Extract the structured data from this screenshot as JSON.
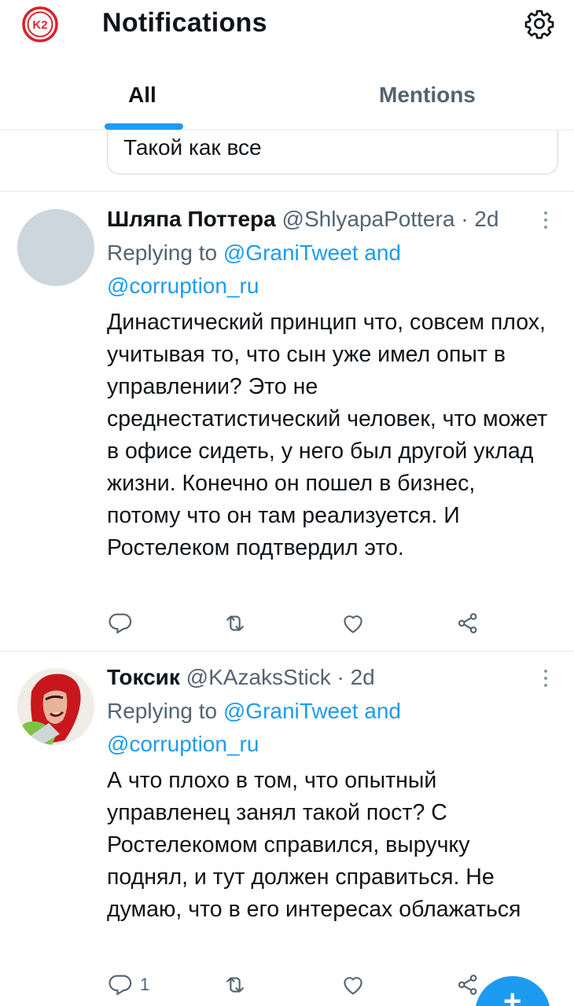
{
  "header": {
    "title": "Notifications",
    "logo_icon": "k2-logo-icon",
    "settings_icon": "gear-icon"
  },
  "tabs": [
    {
      "label": "All",
      "active": true
    },
    {
      "label": "Mentions",
      "active": false
    }
  ],
  "previous_item": {
    "text": "Такой как все"
  },
  "tweets": [
    {
      "name": "Шляпа Поттера",
      "handle": "@ShlyapaPottera",
      "separator": "·",
      "time": "2d",
      "reply_prefix": "Replying to",
      "reply_user1": "@GraniTweet",
      "reply_and": "and",
      "reply_user2": "@corruption_ru",
      "text": "Династический принцип что, совсем плох, учитывая то, что сын уже имел опыт в управлении? Это не среднестатистический человек, что может в офисе сидеть, у него был другой уклад жизни. Конечно он пошел в бизнес, потому что он там реализуется. И Ростелеком подтвердил это.",
      "reply_count": "",
      "retweet_count": "",
      "like_count": ""
    },
    {
      "name": "Токсик",
      "handle": "@KAzaksStick",
      "separator": "·",
      "time": "2d",
      "reply_prefix": "Replying to",
      "reply_user1": "@GraniTweet",
      "reply_and": "and",
      "reply_user2": "@corruption_ru",
      "text": "А что плохо в том, что опытный управленец занял такой пост? С Ростелекомом справился, выручку поднял, и тут должен справиться. Не думаю, что в его интересах облажаться",
      "reply_count": "1",
      "retweet_count": "",
      "like_count": ""
    }
  ],
  "colors": {
    "accent": "#1d9bf0",
    "secondary_text": "#536471",
    "divider": "#e6ecf0",
    "logo_red": "#d8232a"
  },
  "fab": {
    "icon": "plus-icon",
    "label": "+"
  }
}
